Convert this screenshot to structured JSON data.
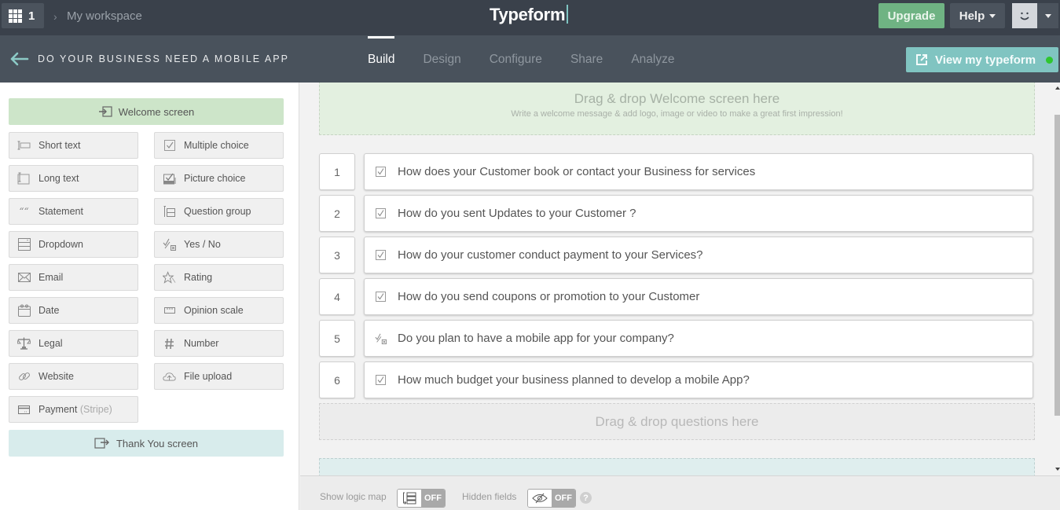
{
  "topbar": {
    "apps_count": "1",
    "breadcrumb": "My workspace",
    "brand": "Typeform",
    "upgrade_label": "Upgrade",
    "help_label": "Help"
  },
  "subbar": {
    "form_title": "DO YOUR BUSINESS NEED A MOBILE APP",
    "tabs": [
      {
        "label": "Build",
        "active": true
      },
      {
        "label": "Design",
        "active": false
      },
      {
        "label": "Configure",
        "active": false
      },
      {
        "label": "Share",
        "active": false
      },
      {
        "label": "Analyze",
        "active": false
      }
    ],
    "view_label": "View my typeform",
    "view_status_color": "#2fc62f"
  },
  "left_panel": {
    "welcome_label": "Welcome screen",
    "thanks_label": "Thank You screen",
    "question_types": [
      {
        "label": "Short text",
        "icon": "short-text-icon"
      },
      {
        "label": "Multiple choice",
        "icon": "multiple-choice-icon"
      },
      {
        "label": "Long text",
        "icon": "long-text-icon"
      },
      {
        "label": "Picture choice",
        "icon": "picture-choice-icon"
      },
      {
        "label": "Statement",
        "icon": "quote-icon"
      },
      {
        "label": "Question group",
        "icon": "question-group-icon"
      },
      {
        "label": "Dropdown",
        "icon": "dropdown-icon"
      },
      {
        "label": "Yes / No",
        "icon": "yes-no-icon"
      },
      {
        "label": "Email",
        "icon": "envelope-icon"
      },
      {
        "label": "Rating",
        "icon": "star-icon"
      },
      {
        "label": "Date",
        "icon": "calendar-icon"
      },
      {
        "label": "Opinion scale",
        "icon": "scale-icon"
      },
      {
        "label": "Legal",
        "icon": "legal-scales-icon"
      },
      {
        "label": "Number",
        "icon": "hash-icon"
      },
      {
        "label": "Website",
        "icon": "link-icon"
      },
      {
        "label": "File upload",
        "icon": "cloud-upload-icon"
      },
      {
        "label": "Payment",
        "suffix": "(Stripe)",
        "icon": "credit-card-icon"
      }
    ]
  },
  "canvas": {
    "welcome_drop_title": "Drag & drop Welcome screen here",
    "welcome_drop_subtitle": "Write a welcome message & add logo, image or video to make a great first impression!",
    "questions": [
      {
        "number": "1",
        "type": "multiple-choice",
        "text": "How does your Customer book or contact your Business for services"
      },
      {
        "number": "2",
        "type": "multiple-choice",
        "text": "How do you sent Updates to your Customer ?"
      },
      {
        "number": "3",
        "type": "multiple-choice",
        "text": "How do your customer conduct payment to your Services?"
      },
      {
        "number": "4",
        "type": "multiple-choice",
        "text": "How do you send coupons or promotion to your Customer"
      },
      {
        "number": "5",
        "type": "yes-no",
        "text": "Do you plan to have a mobile app for your company?"
      },
      {
        "number": "6",
        "type": "multiple-choice",
        "text": "How much budget your business planned to develop a mobile App?"
      }
    ],
    "questions_drop": "Drag & drop questions here"
  },
  "footer": {
    "logic_map_label": "Show logic map",
    "logic_map_state": "OFF",
    "hidden_fields_label": "Hidden fields",
    "hidden_fields_state": "OFF",
    "help_glyph": "?"
  }
}
